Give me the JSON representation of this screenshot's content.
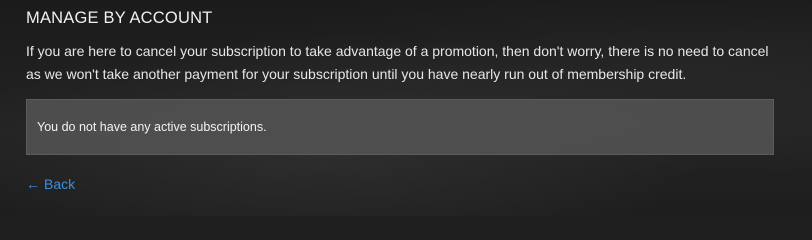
{
  "page": {
    "title": "MANAGE BY ACCOUNT",
    "description": "If you are here to cancel your subscription to take advantage of a promotion, then don't worry, there is no need to cancel as we won't take another payment for your subscription until you have nearly run out of membership credit."
  },
  "subscriptions_panel": {
    "message": "You do not have any active subscriptions."
  },
  "back_link": {
    "label": "Back",
    "icon": "left-arrow-icon",
    "color": "#3a8fe0"
  }
}
